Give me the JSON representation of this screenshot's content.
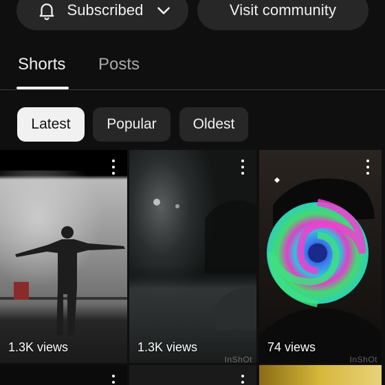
{
  "actions": {
    "subscribed_label": "Subscribed",
    "community_label": "Visit community"
  },
  "tabs": [
    {
      "label": "Shorts",
      "selected": true
    },
    {
      "label": "Posts",
      "selected": false
    }
  ],
  "filters": [
    {
      "label": "Latest",
      "selected": true
    },
    {
      "label": "Popular",
      "selected": false
    },
    {
      "label": "Oldest",
      "selected": false
    }
  ],
  "shorts": [
    {
      "views": "1.3K views",
      "watermark": ""
    },
    {
      "views": "1.3K views",
      "watermark": "InShOt"
    },
    {
      "views": "74 views",
      "watermark": "InShOt"
    }
  ],
  "colors": {
    "background": "#0f0f0f",
    "pill": "#272727",
    "selected_chip": "#f1f1f1",
    "muted_text": "#aaaaaa"
  }
}
